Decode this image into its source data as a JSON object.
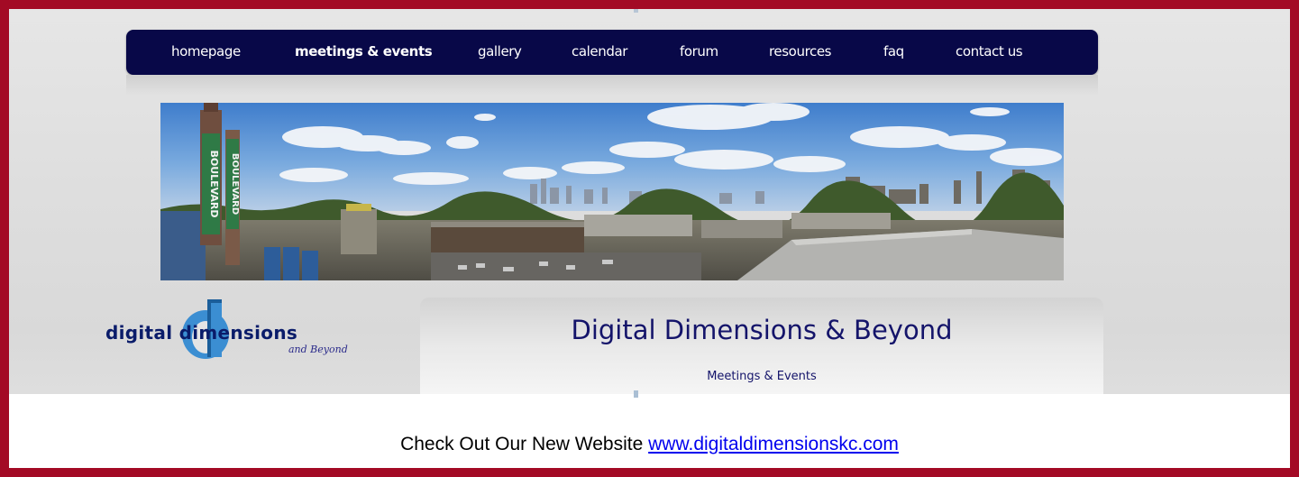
{
  "nav": {
    "items": [
      {
        "label": "homepage",
        "active": false
      },
      {
        "label": "meetings & events",
        "active": true
      },
      {
        "label": "gallery",
        "active": false
      },
      {
        "label": "calendar",
        "active": false
      },
      {
        "label": "forum",
        "active": false
      },
      {
        "label": "resources",
        "active": false
      },
      {
        "label": "faq",
        "active": false
      },
      {
        "label": "contact us",
        "active": false
      }
    ]
  },
  "banner": {
    "chimney_text": "BOULEVARD"
  },
  "logo": {
    "wordmark": "digital dimensions",
    "tagline": "and Beyond"
  },
  "header": {
    "title": "Digital Dimensions & Beyond",
    "subtitle": "Meetings & Events"
  },
  "notice": {
    "text": "Check Out Our New Website",
    "link_text": "www.digitaldimensionskc.com"
  },
  "colors": {
    "frame_border": "#a30a25",
    "nav_background": "#080848",
    "title_text": "#14146a",
    "link": "#0000ee"
  }
}
